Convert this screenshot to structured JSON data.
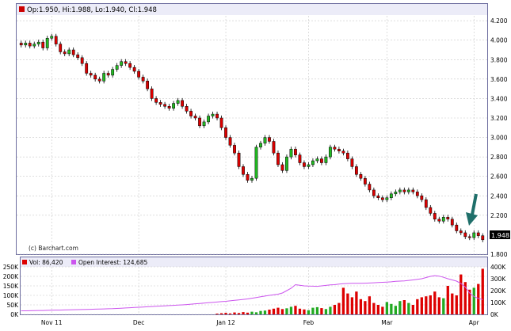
{
  "chart_data": {
    "type": "candlestick",
    "credit": "(c) Barchart.com",
    "colors": {
      "up": "#22bb22",
      "down": "#dd0000",
      "volume_up": "#22aa22",
      "volume_down": "#dd0000",
      "open_interest": "#cc55ee",
      "grid": "#c8c8c8",
      "frame": "#6c6c9e",
      "header_bg": "#ececf8",
      "arrow": "#1f6f6a"
    },
    "price_panel": {
      "header": {
        "symbol_color": "#cc0000",
        "text": "Op:1.950, Hi:1.988, Lo:1.940, Cl:1.948"
      },
      "ylim": [
        1.8,
        4.25
      ],
      "y_ticks": [
        "4.200",
        "4.000",
        "3.800",
        "3.600",
        "3.400",
        "3.200",
        "3.000",
        "2.800",
        "2.600",
        "2.400",
        "2.200",
        "1.800"
      ],
      "y_tick_values": [
        4.2,
        4.0,
        3.8,
        3.6,
        3.4,
        3.2,
        3.0,
        2.8,
        2.6,
        2.4,
        2.2,
        1.8
      ],
      "last_price_label": "1.948",
      "last_price": 1.948,
      "annotation": "arrow-down",
      "closes": [
        3.95,
        3.97,
        3.94,
        3.96,
        3.98,
        3.92,
        4.02,
        4.04,
        3.96,
        3.88,
        3.86,
        3.9,
        3.85,
        3.82,
        3.76,
        3.66,
        3.64,
        3.6,
        3.58,
        3.66,
        3.64,
        3.7,
        3.74,
        3.78,
        3.76,
        3.72,
        3.68,
        3.62,
        3.58,
        3.5,
        3.4,
        3.36,
        3.34,
        3.32,
        3.3,
        3.35,
        3.38,
        3.32,
        3.27,
        3.22,
        3.2,
        3.12,
        3.16,
        3.22,
        3.24,
        3.2,
        3.1,
        3.0,
        2.92,
        2.84,
        2.7,
        2.62,
        2.56,
        2.58,
        2.9,
        2.94,
        3.0,
        2.96,
        2.84,
        2.72,
        2.66,
        2.8,
        2.88,
        2.82,
        2.74,
        2.7,
        2.72,
        2.76,
        2.78,
        2.74,
        2.8,
        2.9,
        2.88,
        2.86,
        2.84,
        2.78,
        2.7,
        2.62,
        2.58,
        2.52,
        2.46,
        2.4,
        2.38,
        2.36,
        2.38,
        2.42,
        2.44,
        2.46,
        2.44,
        2.46,
        2.44,
        2.4,
        2.36,
        2.28,
        2.22,
        2.16,
        2.14,
        2.18,
        2.16,
        2.1,
        2.04,
        2.02,
        1.98,
        1.97,
        2.02,
        1.99,
        1.948
      ],
      "x_ticks": [
        {
          "label": "Nov 11",
          "index": 7
        },
        {
          "label": "Dec",
          "index": 27
        },
        {
          "label": "Jan 12",
          "index": 47
        },
        {
          "label": "Feb",
          "index": 66
        },
        {
          "label": "Mar",
          "index": 84
        },
        {
          "label": "Apr",
          "index": 104
        }
      ]
    },
    "volume_panel": {
      "legend": [
        {
          "name": "Vol: 86,420",
          "color": "#dd0000"
        },
        {
          "name": "Open Interest: 124,685",
          "color": "#cc55ee"
        }
      ],
      "ylim": [
        0,
        250000
      ],
      "y_ticks_left": [
        "250K",
        "200K",
        "150K",
        "100K",
        "50K",
        "0K"
      ],
      "y_tick_left_values": [
        250000,
        200000,
        150000,
        100000,
        50000,
        0
      ],
      "oi_ylim": [
        0,
        400000
      ],
      "y_ticks_right": [
        "400K",
        "300K",
        "200K",
        "100K",
        "0K"
      ],
      "y_tick_right_values": [
        400000,
        300000,
        200000,
        100000,
        0
      ],
      "volume_start_index": 45,
      "volumes": [
        4000,
        6000,
        8000,
        5000,
        10000,
        7000,
        12000,
        9000,
        14000,
        11000,
        18000,
        20000,
        25000,
        30000,
        35000,
        28000,
        32000,
        40000,
        45000,
        30000,
        26000,
        22000,
        35000,
        38000,
        33000,
        28000,
        40000,
        50000,
        60000,
        140000,
        110000,
        90000,
        120000,
        80000,
        70000,
        95000,
        60000,
        50000,
        40000,
        65000,
        55000,
        45000,
        70000,
        75000,
        60000,
        50000,
        80000,
        90000,
        95000,
        100000,
        120000,
        90000,
        85000,
        150000,
        110000,
        100000,
        210000,
        170000,
        130000,
        140000,
        160000,
        240000,
        190000,
        150000,
        120000,
        86420
      ],
      "open_interest": [
        30000,
        30000,
        31000,
        32000,
        33000,
        33000,
        34000,
        35000,
        36000,
        36000,
        37000,
        38000,
        39000,
        40000,
        41000,
        42000,
        43000,
        44000,
        45000,
        46000,
        47000,
        48000,
        50000,
        52000,
        54000,
        56000,
        58000,
        60000,
        62000,
        64000,
        66000,
        68000,
        70000,
        72000,
        74000,
        76000,
        78000,
        80000,
        83000,
        86000,
        89000,
        92000,
        95000,
        98000,
        101000,
        104000,
        107000,
        110000,
        114000,
        118000,
        122000,
        126000,
        130000,
        136000,
        142000,
        148000,
        154000,
        160000,
        165000,
        170000,
        180000,
        200000,
        220000,
        250000,
        245000,
        240000,
        238000,
        237000,
        236000,
        240000,
        244000,
        248000,
        250000,
        255000,
        258000,
        260000,
        262000,
        262000,
        262000,
        263000,
        264000,
        266000,
        268000,
        270000,
        272000,
        274000,
        278000,
        280000,
        282000,
        286000,
        290000,
        295000,
        300000,
        310000,
        320000,
        326000,
        322000,
        312000,
        300000,
        290000,
        280000,
        260000,
        230000,
        180000,
        150000,
        135000,
        124685
      ]
    }
  }
}
